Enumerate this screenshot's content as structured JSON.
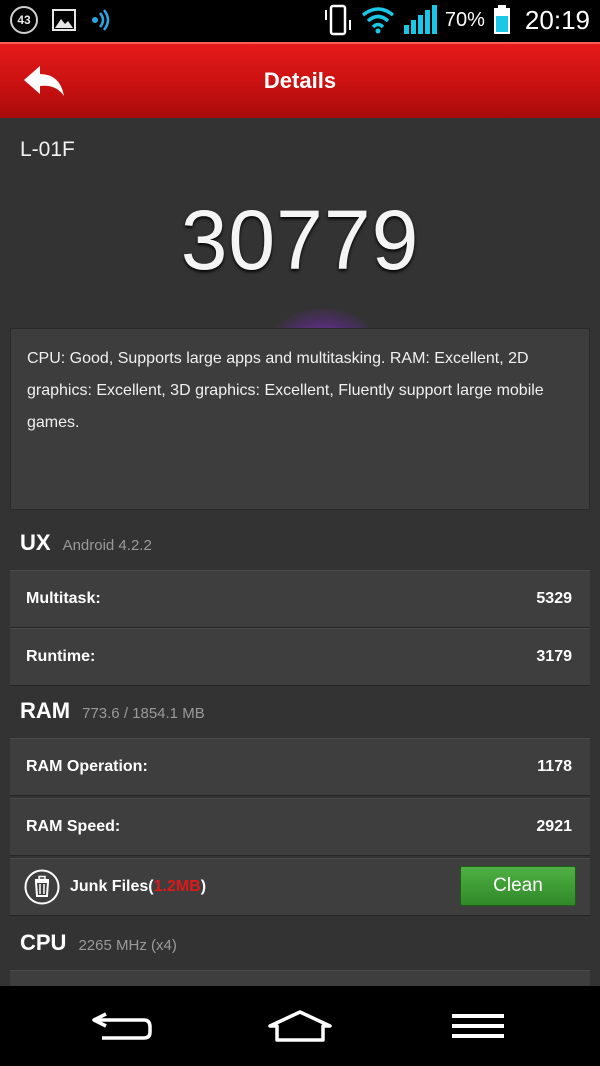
{
  "status_bar": {
    "notification_count": "43",
    "battery_percent": "70%",
    "time": "20:19",
    "icons": [
      "gallery-icon",
      "nfc-icon",
      "vibrate-icon",
      "wifi-icon",
      "signal-icon",
      "battery-icon"
    ]
  },
  "header": {
    "title": "Details",
    "back_icon": "back-arrow-icon"
  },
  "device": {
    "name": "L-01F",
    "score": "30779"
  },
  "description": "CPU: Good, Supports large apps and multitasking. RAM: Excellent, 2D graphics: Excellent, 3D graphics: Excellent, Fluently support large mobile games.",
  "ux": {
    "title": "UX",
    "subtitle": "Android 4.2.2",
    "rows": [
      {
        "label": "Multitask:",
        "value": "5329"
      },
      {
        "label": "Runtime:",
        "value": "3179"
      }
    ]
  },
  "ram": {
    "title": "RAM",
    "subtitle": "773.6 / 1854.1 MB",
    "rows": [
      {
        "label": "RAM Operation:",
        "value": "1178"
      },
      {
        "label": "RAM Speed:",
        "value": "2921"
      }
    ],
    "junk": {
      "label": "Junk Files(",
      "size": "1.2MB",
      "close": ")",
      "button": "Clean"
    }
  },
  "cpu": {
    "title": "CPU",
    "subtitle": "2265 MHz (x4)"
  },
  "colors": {
    "header_red": "#c61010",
    "junk_size_red": "#e01818",
    "clean_green": "#3d9c34",
    "background": "#333333"
  }
}
